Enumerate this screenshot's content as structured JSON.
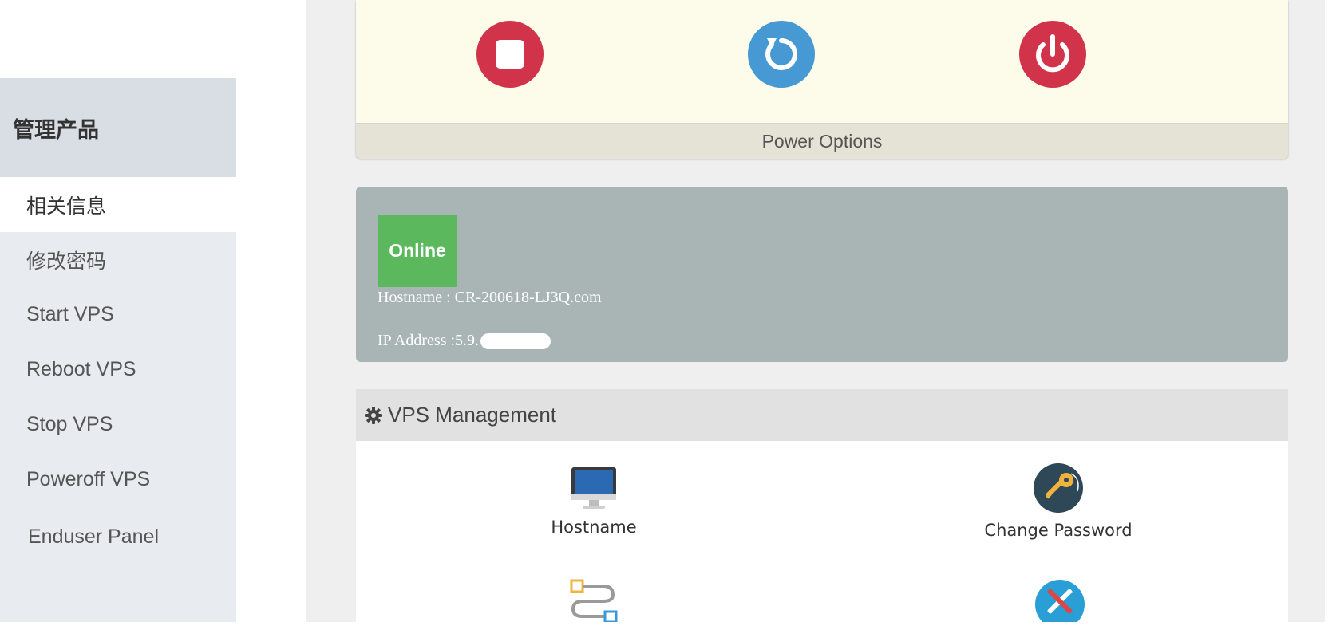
{
  "sidebar": {
    "title": "管理产品",
    "items": [
      {
        "label": "相关信息",
        "active": true
      },
      {
        "label": "修改密码",
        "active": false
      },
      {
        "label": "Start VPS",
        "active": false
      },
      {
        "label": "Reboot VPS",
        "active": false
      },
      {
        "label": "Stop VPS",
        "active": false
      },
      {
        "label": "Poweroff VPS",
        "active": false
      },
      {
        "label": "Enduser Panel",
        "active": false
      }
    ]
  },
  "power": {
    "footer_label": "Power Options",
    "buttons": [
      {
        "icon": "stop-icon",
        "color": "#d0334a"
      },
      {
        "icon": "reboot-icon",
        "color": "#4699d2"
      },
      {
        "icon": "power-icon",
        "color": "#d0334a"
      }
    ]
  },
  "status": {
    "badge": "Online",
    "badge_color": "#5cb85c",
    "hostname_line": "Hostname : CR-200618-LJ3Q.com",
    "ip_prefix": "IP Address :5.9."
  },
  "management": {
    "title": "VPS Management",
    "title_icon": "gear-icon",
    "tiles": [
      {
        "label": "Hostname",
        "icon": "monitor-icon"
      },
      {
        "label": "Change Password",
        "icon": "key-icon"
      },
      {
        "label": "",
        "icon": "network-icon"
      },
      {
        "label": "",
        "icon": "tools-icon"
      }
    ]
  }
}
